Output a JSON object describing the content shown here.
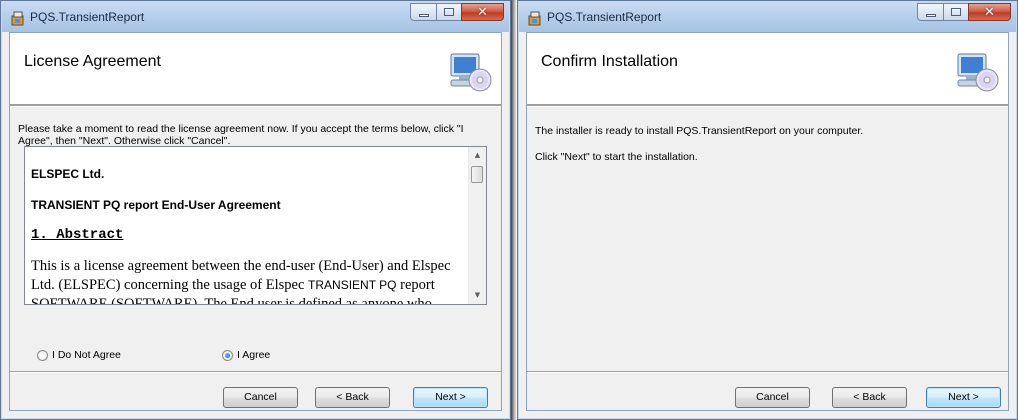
{
  "left_window": {
    "title": "PQS.TransientReport",
    "banner_title": "License Agreement",
    "instructions": "Please take a moment to read the license agreement now. If you accept the terms below, click \"I Agree\", then \"Next\". Otherwise click \"Cancel\".",
    "license": {
      "company": "ELSPEC Ltd.",
      "heading": "TRANSIENT PQ report End-User Agreement",
      "section": "1. Abstract",
      "para_part1": "This is a license agreement between the end-user (End-User) and Elspec Ltd. (ELSPEC) concerning the usage of Elspec ",
      "para_sans": "TRANSIENT PQ",
      "para_part2": " report SOFTWARE (SOFTWARE). The End user is defined as anyone who"
    },
    "radio_disagree": "I Do Not Agree",
    "radio_agree": "I Agree",
    "cancel": "Cancel",
    "back": "< Back",
    "next": "Next >"
  },
  "right_window": {
    "title": "PQS.TransientReport",
    "banner_title": "Confirm Installation",
    "line1": "The installer is ready to install PQS.TransientReport on your computer.",
    "line2": "Click \"Next\" to start the installation.",
    "cancel": "Cancel",
    "back": "< Back",
    "next": "Next >"
  },
  "icons": {
    "app": "installer-app-icon",
    "banner": "computer-cd-icon",
    "minimize": "minimize-icon",
    "maximize": "maximize-icon",
    "close": "close-icon"
  },
  "colors": {
    "titlebar": "#b7cfeb",
    "close_button": "#c13c22",
    "default_button_border": "#3c7fb1",
    "client_bg": "#f0f0f0"
  }
}
